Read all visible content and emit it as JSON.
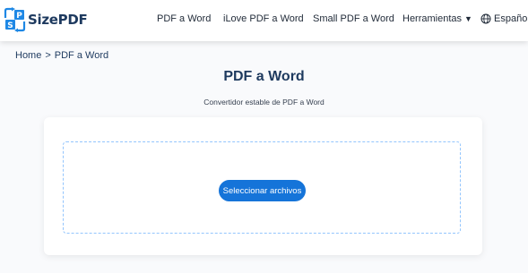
{
  "header": {
    "logo_text": "SizePDF",
    "logo_letters": [
      "P",
      "S"
    ],
    "nav": [
      {
        "label": "PDF a Word"
      },
      {
        "label": "iLove PDF a Word"
      },
      {
        "label": "Small PDF a Word"
      },
      {
        "label": "Herramientas",
        "caret": "▼"
      }
    ],
    "language": "Español"
  },
  "breadcrumb": {
    "home": "Home",
    "separator": ">",
    "current": "PDF a Word"
  },
  "main": {
    "title": "PDF a Word",
    "subtitle": "Convertidor estable de PDF a Word",
    "upload_button": "Seleccionar archivos"
  },
  "colors": {
    "brand_dark": "#1e3a5f",
    "logo_blue": "#1e88e5",
    "button": "#1574d9",
    "dropzone_border": "#93c5fd"
  }
}
